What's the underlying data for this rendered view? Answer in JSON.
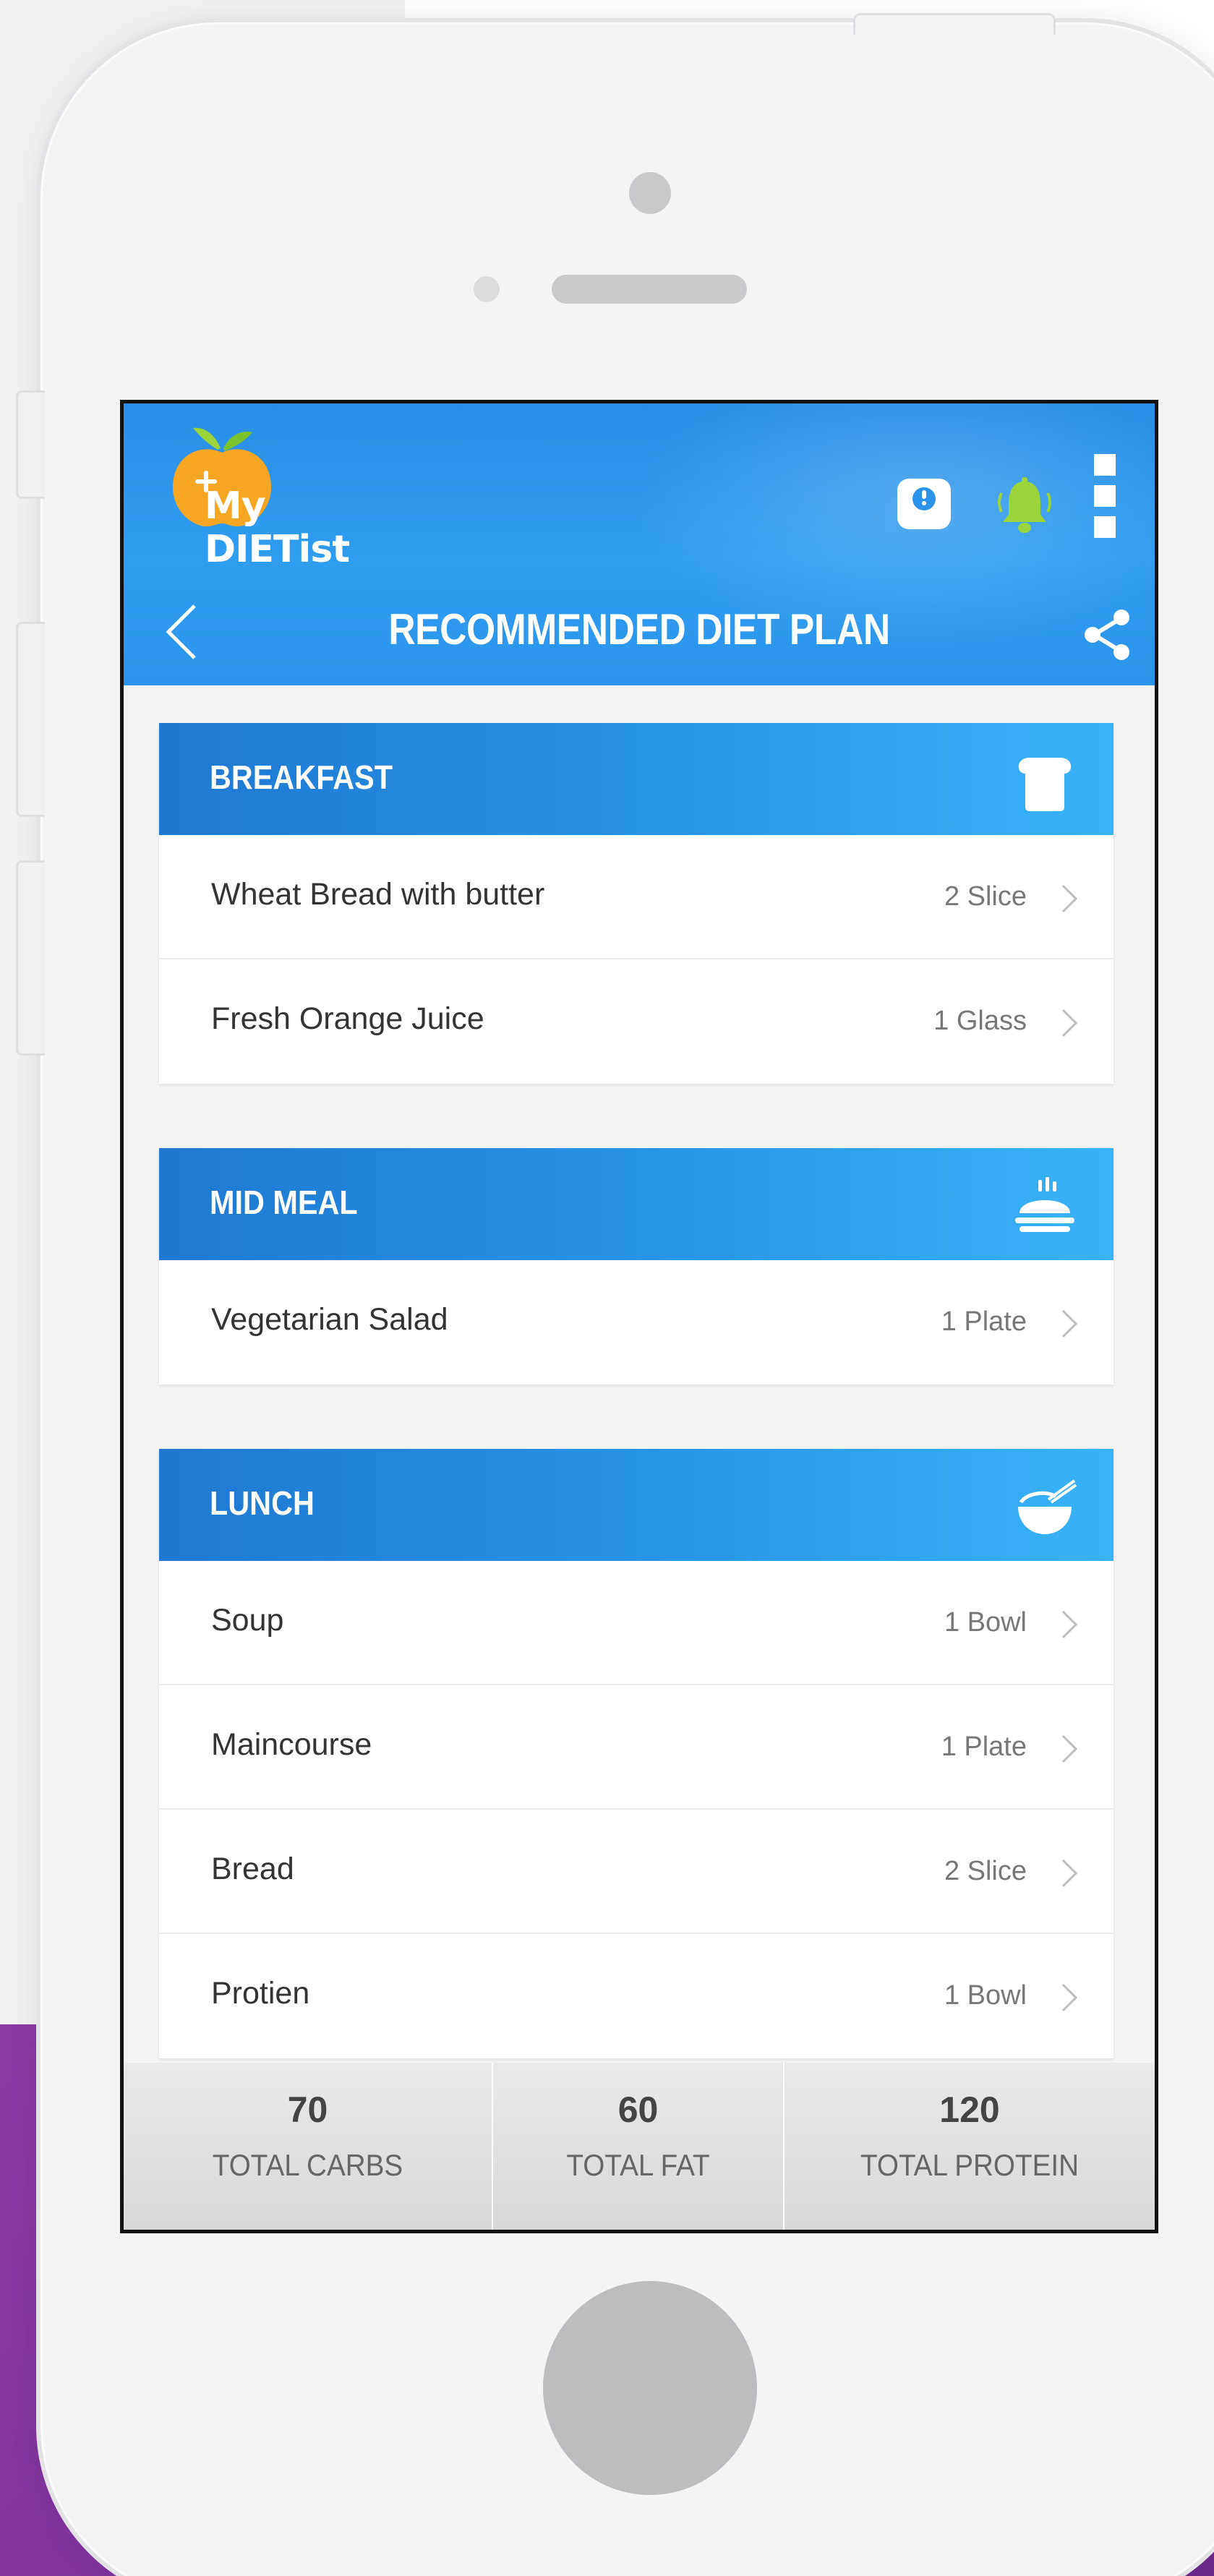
{
  "app": {
    "name": "My DIETist",
    "page_title": "RECOMMENDED DIET PLAN"
  },
  "header_icons": [
    "weight-scale-icon",
    "bell-icon",
    "more-vertical-icon"
  ],
  "colors": {
    "header_blue": "#2b94ea",
    "section_blue": "#2896e8",
    "accent_green": "#9bd53c",
    "purple_bg": "#7a2f9a"
  },
  "sections": [
    {
      "title": "BREAKFAST",
      "icon": "bread-icon",
      "items": [
        {
          "name": "Wheat Bread with butter",
          "qty": "2 Slice"
        },
        {
          "name": "Fresh Orange Juice",
          "qty": "1 Glass"
        }
      ]
    },
    {
      "title": "MID MEAL",
      "icon": "hot-plate-icon",
      "items": [
        {
          "name": "Vegetarian Salad",
          "qty": "1 Plate"
        }
      ]
    },
    {
      "title": "LUNCH",
      "icon": "bowl-icon",
      "items": [
        {
          "name": "Soup",
          "qty": "1 Bowl"
        },
        {
          "name": "Maincourse",
          "qty": "1 Plate"
        },
        {
          "name": "Bread",
          "qty": "2 Slice"
        },
        {
          "name": "Protien",
          "qty": "1 Bowl"
        }
      ]
    }
  ],
  "totals": [
    {
      "value": "70",
      "label": "TOTAL CARBS"
    },
    {
      "value": "60",
      "label": "TOTAL FAT"
    },
    {
      "value": "120",
      "label": "TOTAL PROTEIN"
    }
  ]
}
